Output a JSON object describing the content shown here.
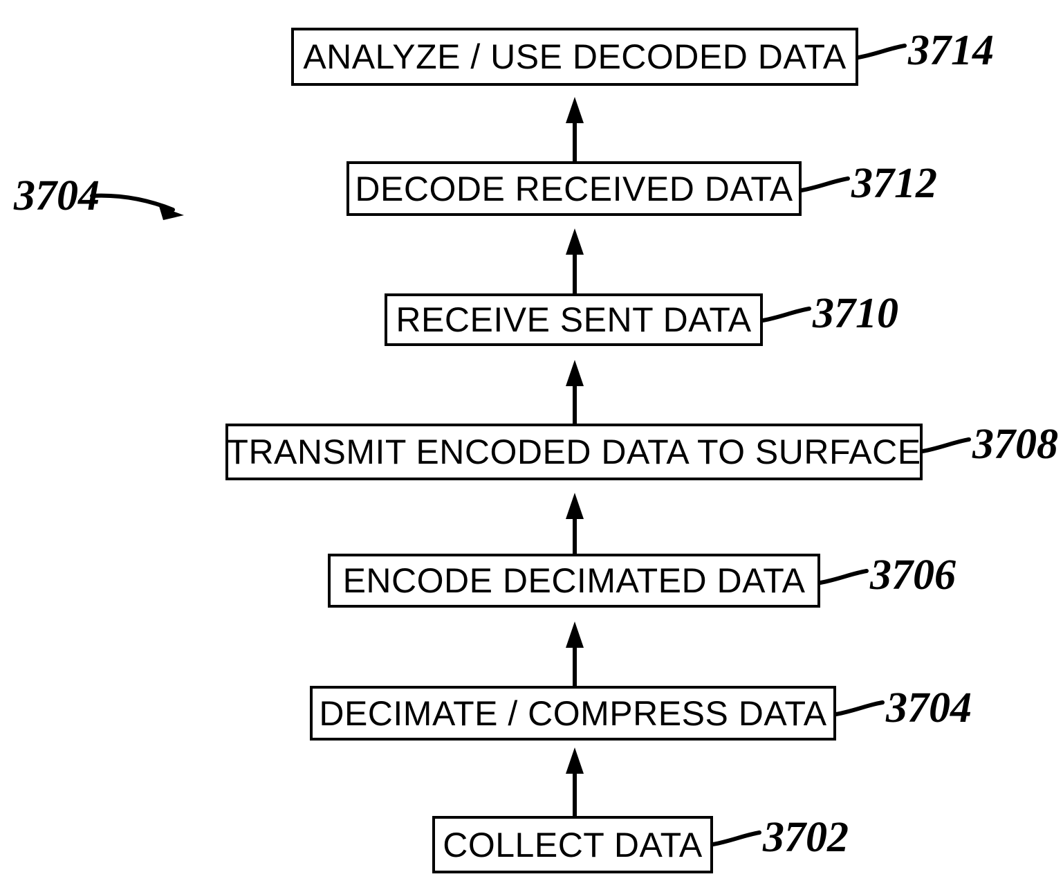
{
  "figure": {
    "type": "patent-flowchart",
    "title": "",
    "orientation": "bottom-to-top",
    "pointer_label": "3704",
    "steps": [
      {
        "id": "step-3714",
        "label": "ANALYZE / USE DECODED DATA",
        "ref": "3714",
        "order": 7
      },
      {
        "id": "step-3712",
        "label": "DECODE RECEIVED DATA",
        "ref": "3712",
        "order": 6
      },
      {
        "id": "step-3710",
        "label": "RECEIVE SENT DATA",
        "ref": "3710",
        "order": 5
      },
      {
        "id": "step-3708",
        "label": "TRANSMIT ENCODED DATA TO SURFACE",
        "ref": "3708",
        "order": 4
      },
      {
        "id": "step-3706",
        "label": "ENCODE DECIMATED DATA",
        "ref": "3706",
        "order": 3
      },
      {
        "id": "step-3704",
        "label": "DECIMATE / COMPRESS DATA",
        "ref": "3704",
        "order": 2
      },
      {
        "id": "step-3702",
        "label": "COLLECT DATA",
        "ref": "3702",
        "order": 1
      }
    ],
    "colors": {
      "line": "#000000",
      "background": "#ffffff",
      "text": "#000000"
    }
  }
}
